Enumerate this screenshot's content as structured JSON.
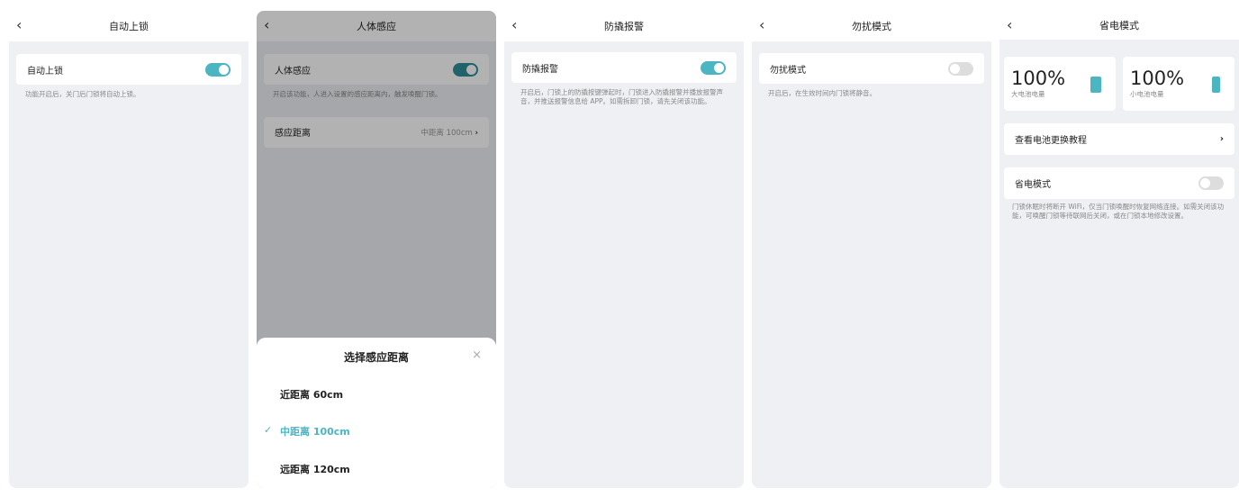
{
  "auto_lock": {
    "title": "自动上锁",
    "row": "自动上锁",
    "toggle_on": true,
    "desc": "功能开启后，关门后门锁将自动上锁。"
  },
  "body_sense": {
    "title": "人体感应",
    "row": "人体感应",
    "toggle_on": true,
    "desc": "开启该功能，人进入设置的感应距离内，触发唤醒门锁。",
    "distance_label": "感应距离",
    "distance_value": "中距离 100cm",
    "sheet": {
      "title": "选择感应距离",
      "options": [
        "近距离 60cm",
        "中距离 100cm",
        "远距离 120cm"
      ],
      "selected": 1
    }
  },
  "tamper": {
    "title": "防撬报警",
    "row": "防撬报警",
    "toggle_on": true,
    "desc": "开启后，门锁上的防撬按键弹起时，门锁进入防撬报警并播放报警声音，并推送报警信息给 APP。如需拆卸门锁，请先关闭该功能。"
  },
  "dnd": {
    "title": "勿扰模式",
    "row": "勿扰模式",
    "toggle_on": false,
    "desc": "开启后，在生效时间内门锁将静音。"
  },
  "power": {
    "title": "省电模式",
    "big_pct": "100%",
    "big_label": "大电池电量",
    "small_pct": "100%",
    "small_label": "小电池电量",
    "tutorial": "查看电池更换教程",
    "row": "省电模式",
    "toggle_on": false,
    "desc": "门锁休眠时将断开 WiFi，仅当门锁唤醒时恢复网络连接。如需关闭该功能，可唤醒门锁等待联网后关闭，或在门锁本地修改设置。"
  },
  "colors": {
    "accent": "#4bb5c1"
  }
}
